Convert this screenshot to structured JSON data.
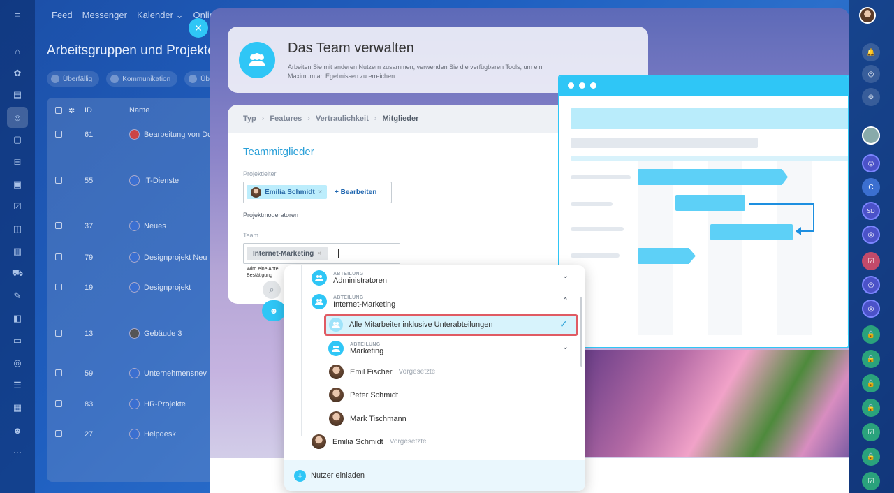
{
  "topnav": [
    "Feed",
    "Messenger",
    "Kalender ⌄",
    "Online"
  ],
  "bg_title": "Arbeitsgruppen und Projekte",
  "chips": [
    "Überfällig",
    "Kommunikation",
    "Über"
  ],
  "table": {
    "headers": {
      "id": "ID",
      "name": "Name"
    },
    "rows": [
      {
        "id": "61",
        "name": "Bearbeitung von Do"
      },
      {
        "id": "55",
        "name": "IT-Dienste"
      },
      {
        "id": "37",
        "name": "Neues"
      },
      {
        "id": "79",
        "name": "Designprojekt Neu"
      },
      {
        "id": "19",
        "name": "Designprojekt"
      },
      {
        "id": "13",
        "name": "Gebäude 3"
      },
      {
        "id": "59",
        "name": "Unternehmensnev"
      },
      {
        "id": "83",
        "name": "HR-Projekte"
      },
      {
        "id": "27",
        "name": "Helpdesk"
      }
    ]
  },
  "header_card": {
    "title": "Das Team verwalten",
    "description": "Arbeiten Sie mit anderen Nutzern zusammen, verwenden Sie die verfügbaren Tools, um ein Maximum an Egebnissen zu erreichen."
  },
  "breadcrumbs": [
    "Typ",
    "Features",
    "Vertraulichkeit",
    "Mitglieder"
  ],
  "form": {
    "heading": "Teammitglieder",
    "leader_label": "Projektleiter",
    "leader_name": "Emilia Schmidt",
    "edit_label": "+ Bearbeiten",
    "moderators_label": "Projektmoderatoren",
    "team_label": "Team",
    "team_tag": "Internet-Marketing",
    "hint": "Wird eine Abtei Bestätigung"
  },
  "dropdown": {
    "dept_tag": "ABTEILUNG",
    "items": [
      {
        "name": "Administratoren"
      },
      {
        "name": "Internet-Marketing"
      },
      {
        "name": "Alle Mitarbeiter inklusive Unterabteilungen"
      },
      {
        "name": "Marketing"
      },
      {
        "name": "Emil Fischer",
        "role": "Vorgesetzte"
      },
      {
        "name": "Peter Schmidt"
      },
      {
        "name": "Mark Tischmann"
      },
      {
        "name": "Emilia Schmidt",
        "role": "Vorgesetzte"
      }
    ],
    "invite_label": "Nutzer einladen"
  },
  "right_bar": {
    "c_label": "C",
    "sd_label": "SD"
  },
  "colors": {
    "accent": "#2fc6f6",
    "highlight_border": "#e05b63",
    "link": "#2067b0"
  }
}
